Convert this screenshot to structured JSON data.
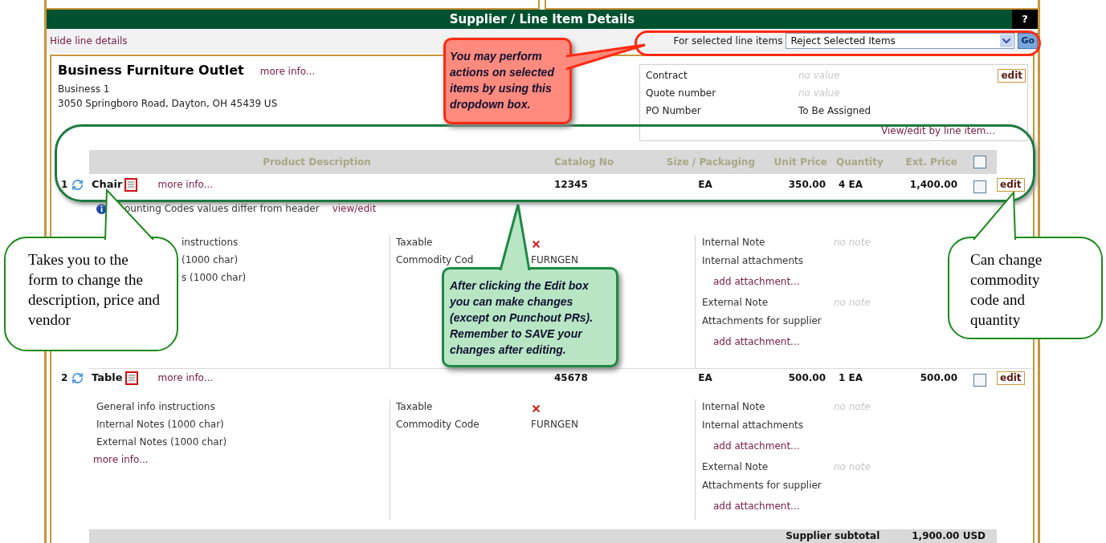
{
  "panel": {
    "title": "Supplier / Line Item Details",
    "help": "?"
  },
  "toolbar": {
    "hide_link": "Hide line details",
    "bulk_label": "For selected line items",
    "bulk_action": "Reject Selected Items",
    "go": "Go"
  },
  "supplier": {
    "name": "Business Furniture Outlet",
    "more_info": "more info...",
    "line1": "Business 1",
    "address": "3050 Springboro Road, Dayton, OH 45439 US"
  },
  "header_fields": {
    "rows": [
      {
        "label": "Contract",
        "value": "no value",
        "empty": true
      },
      {
        "label": "Quote number",
        "value": "no value",
        "empty": true
      },
      {
        "label": "PO Number",
        "value": "To Be Assigned",
        "empty": false
      }
    ],
    "edit": "edit",
    "line_link": "View/edit by line item..."
  },
  "table": {
    "columns": [
      "Product Description",
      "Catalog No",
      "Size / Packaging",
      "Unit Price",
      "Quantity",
      "Ext. Price"
    ],
    "select_all_checked": false
  },
  "items": [
    {
      "number": "1",
      "name": "Chair",
      "more_info": "more info...",
      "catalog": "12345",
      "size": "EA",
      "unit_price": "350.00",
      "quantity": "4 EA",
      "ext_price": "1,400.00",
      "checked": false,
      "edit": "edit",
      "notice": "ounting Codes values differ from header",
      "notice_link": "view/edit",
      "notes": [
        {
          "text": "instructions",
          "kind": "clipped"
        },
        {
          "text": "(1000 char)",
          "kind": "clipped"
        },
        {
          "text": "s (1000 char)",
          "kind": "clipped"
        }
      ],
      "taxable_label": "Taxable",
      "taxable": false,
      "commodity_label": "Commodity Cod",
      "commodity": "FURNGEN",
      "internal_note_label": "Internal Note",
      "internal_note": "no note",
      "internal_attachments_label": "Internal attachments",
      "internal_add": "add attachment...",
      "external_note_label": "External Note",
      "external_note": "no note",
      "supplier_attachments_label": "Attachments for supplier",
      "supplier_add": "add attachment..."
    },
    {
      "number": "2",
      "name": "Table",
      "more_info": "more info...",
      "catalog": "45678",
      "size": "EA",
      "unit_price": "500.00",
      "quantity": "1 EA",
      "ext_price": "500.00",
      "checked": false,
      "edit": "edit",
      "notes": [
        {
          "text": "General info instructions",
          "kind": "full"
        },
        {
          "text": "Internal Notes (1000 char)",
          "kind": "full"
        },
        {
          "text": "External Notes (1000 char)",
          "kind": "full"
        }
      ],
      "notes_link": "more info...",
      "taxable_label": "Taxable",
      "taxable": false,
      "commodity_label": "Commodity Code",
      "commodity": "FURNGEN",
      "internal_note_label": "Internal Note",
      "internal_note": "no note",
      "internal_attachments_label": "Internal attachments",
      "internal_add": "add attachment...",
      "external_note_label": "External Note",
      "external_note": "no note",
      "supplier_attachments_label": "Attachments for supplier",
      "supplier_add": "add attachment..."
    }
  ],
  "subtotal": {
    "label": "Supplier subtotal",
    "value": "1,900.00 USD"
  },
  "callouts": [
    {
      "kind": "alert",
      "text": "You may perform actions on selected items by using this dropdown box."
    },
    {
      "kind": "tip",
      "text": "After clicking the Edit box you can make changes (except on Punchout PRs). Remember to SAVE your changes after editing."
    },
    {
      "kind": "note",
      "text": "Takes you to the form to change the description, price and vendor"
    },
    {
      "kind": "note",
      "text": "Can change commodity code and quantity"
    }
  ]
}
